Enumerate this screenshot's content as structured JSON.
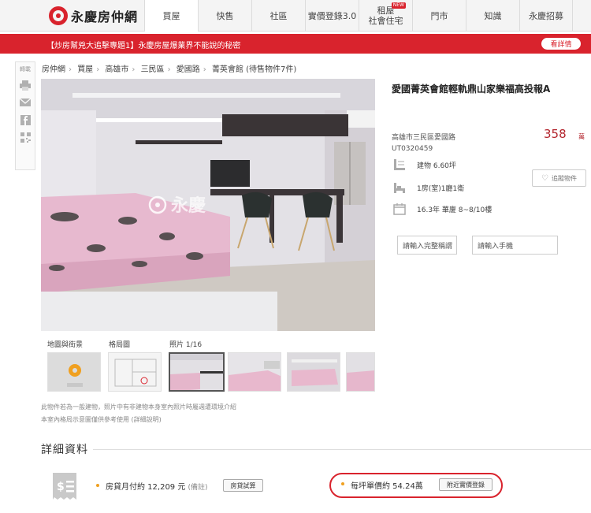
{
  "header": {
    "logo_text": "永慶房仲網",
    "nav": [
      {
        "label": "買屋",
        "active": true
      },
      {
        "label": "快售"
      },
      {
        "label": "社區"
      },
      {
        "label": "實價登錄3.0"
      },
      {
        "label_line1": "租屋",
        "label_line2": "社會住宅",
        "badge": "NEW"
      },
      {
        "label": "門市"
      },
      {
        "label": "知識"
      },
      {
        "label": "永慶招募"
      }
    ]
  },
  "banner": {
    "text": "【炒房幫兇大追擊專題1】永慶房屋爆業界不能說的秘密",
    "button": "看詳情"
  },
  "share": {
    "label": "轉載",
    "icons": [
      "print-icon",
      "mail-icon",
      "facebook-icon",
      "qrcode-icon"
    ]
  },
  "breadcrumb": [
    "房仲網",
    "買屋",
    "高雄市",
    "三民區",
    "愛國路",
    "菁英會館 (待售物件7件)"
  ],
  "gallery": {
    "watermark": "永慶",
    "tabs": [
      "地圖與街景",
      "格局圖",
      "照片 1/16"
    ]
  },
  "notes": [
    "此物件若為一般建物，照片中有非建物本身室內照片時屬週遭環境介紹",
    "本室內格局示意圖僅供參考使用 (詳細說明)"
  ],
  "listing": {
    "title": "愛國菁英會館輕軌鼎山家樂福高投報A",
    "address": "高雄市三民區愛國路",
    "code": "UT0320459",
    "price": "358",
    "price_unit": "萬",
    "specs": [
      {
        "icon": "building-area-icon",
        "text": "建物 6.60坪"
      },
      {
        "icon": "layout-icon",
        "text": "1房(室)1廳1衛"
      },
      {
        "icon": "calendar-icon",
        "text": "16.3年 華廈 8~8/10樓"
      }
    ],
    "track_button": "追蹤物件",
    "input_fullname_placeholder": "請輸入完整稱謂",
    "input_phone_placeholder": "請輸入手機"
  },
  "details": {
    "section_title": "詳細資料",
    "mortgage_text": "房貸月付約 12,209 元",
    "mortgage_note": "(備註)",
    "mortgage_button": "房貸試算",
    "unit_price_text": "每坪單價約 54.24萬",
    "nearby_button": "附近實價登錄"
  },
  "colors": {
    "brand_red": "#d9232d",
    "price_red": "#b3252d",
    "accent_orange": "#f0a020"
  }
}
